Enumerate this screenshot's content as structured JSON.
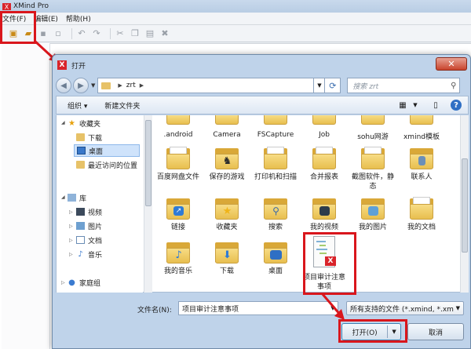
{
  "app": {
    "title": "XMind Pro",
    "menu": [
      "文件(F)",
      "编辑(E)",
      "帮助(H)"
    ]
  },
  "dialog": {
    "title": "打开",
    "close": "✕",
    "path": [
      "zrt"
    ],
    "search_placeholder": "搜索 zrt",
    "organize": "组织 ▾",
    "new_folder": "新建文件夹",
    "nav": {
      "favorites": "收藏夹",
      "downloads": "下载",
      "desktop": "桌面",
      "recent": "最近访问的位置",
      "libraries": "库",
      "videos": "视频",
      "pictures": "图片",
      "documents": "文档",
      "music": "音乐",
      "homegroup": "家庭组"
    },
    "top_row": [
      ".android",
      "Camera",
      "FSCapture",
      "Job",
      "sohu网游",
      "xmind模板"
    ],
    "row1": [
      "百度网盘文件",
      "保存的游戏",
      "打印机和扫描",
      "合并报表",
      "截图软件，静态",
      "联系人"
    ],
    "row2": [
      "链接",
      "收藏夹",
      "搜索",
      "我的视频",
      "我的图片",
      "我的文档"
    ],
    "row3": [
      "我的音乐",
      "下载",
      "桌面",
      "项目审计注意事项"
    ],
    "filename_label": "文件名(N):",
    "filename_value": "项目审计注意事项",
    "filetype_value": "所有支持的文件 (*.xmind, *.xm",
    "open_label": "打开(O)",
    "cancel_label": "取消"
  },
  "colors": {
    "highlight": "#d9161c",
    "accent": "#3c7fb1"
  }
}
